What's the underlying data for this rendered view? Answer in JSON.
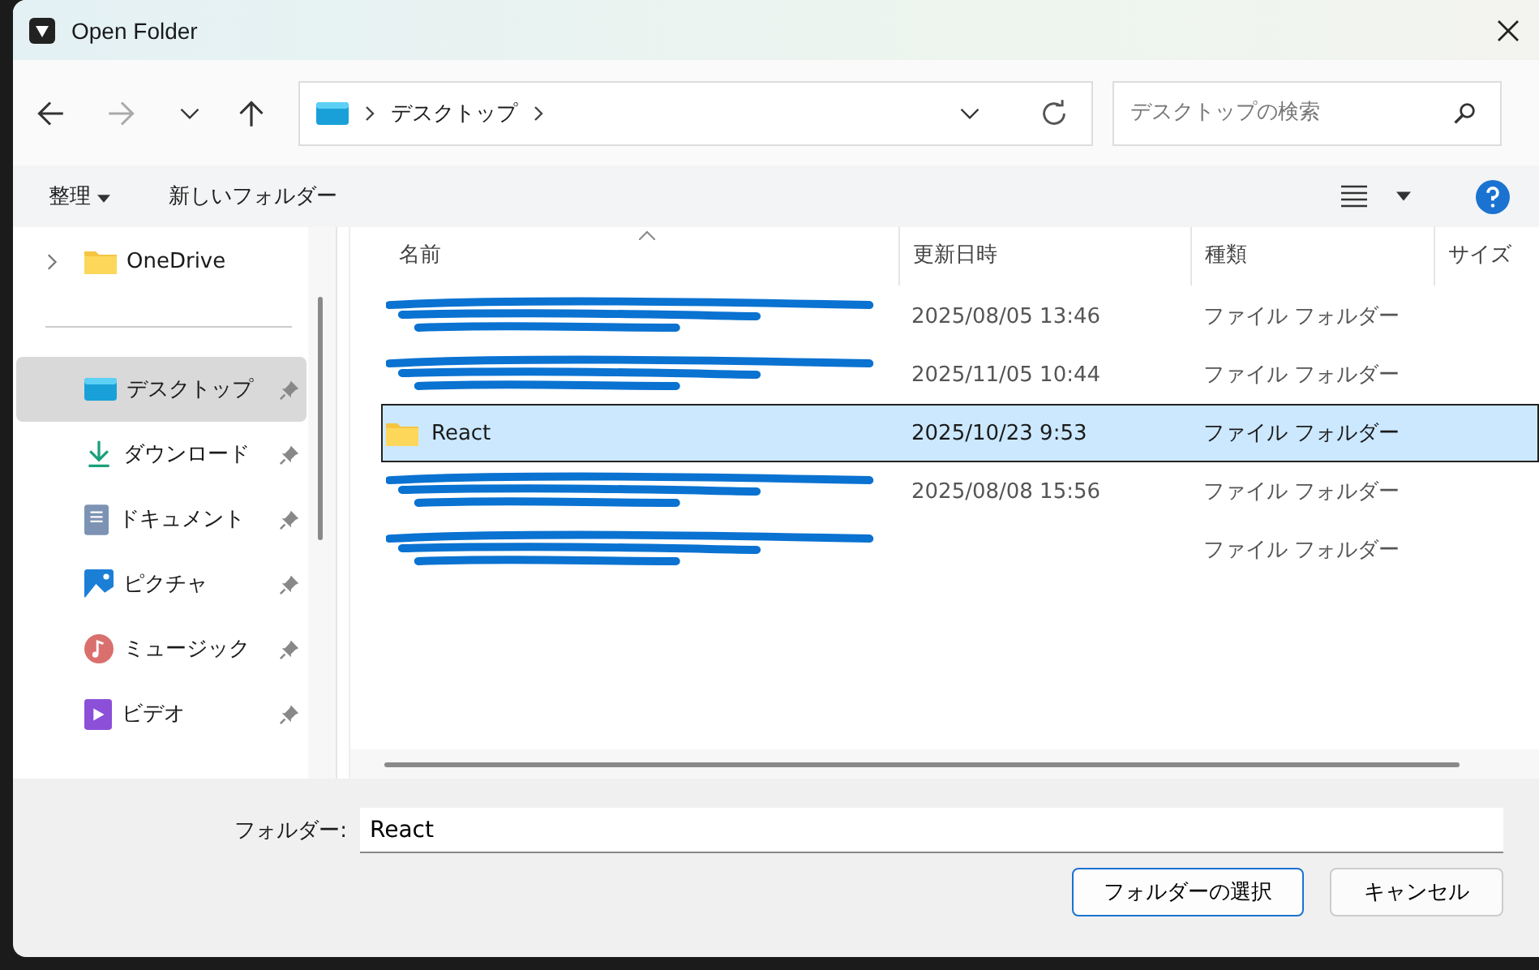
{
  "window": {
    "title": "Open Folder"
  },
  "address": {
    "crumbs": [
      "デスクトップ"
    ]
  },
  "search": {
    "placeholder": "デスクトップの検索"
  },
  "toolbar": {
    "organize": "整理",
    "new_folder": "新しいフォルダー"
  },
  "sidebar": {
    "items": [
      {
        "label": "OneDrive",
        "kind": "onedrive",
        "selected": false,
        "pinned": false
      },
      {
        "label": "デスクトップ",
        "kind": "desktop",
        "selected": true,
        "pinned": true
      },
      {
        "label": "ダウンロード",
        "kind": "download",
        "selected": false,
        "pinned": true
      },
      {
        "label": "ドキュメント",
        "kind": "document",
        "selected": false,
        "pinned": true
      },
      {
        "label": "ピクチャ",
        "kind": "picture",
        "selected": false,
        "pinned": true
      },
      {
        "label": "ミュージック",
        "kind": "music",
        "selected": false,
        "pinned": true
      },
      {
        "label": "ビデオ",
        "kind": "video",
        "selected": false,
        "pinned": true
      }
    ]
  },
  "table": {
    "columns": [
      "名前",
      "更新日時",
      "種類",
      "サイズ"
    ],
    "rows": [
      {
        "redacted": true,
        "modified": "2025/08/05 13:46",
        "type": "ファイル フォルダー",
        "selected": false
      },
      {
        "redacted": true,
        "modified": "2025/11/05 10:44",
        "type": "ファイル フォルダー",
        "selected": false
      },
      {
        "redacted": false,
        "name": "React",
        "modified": "2025/10/23 9:53",
        "type": "ファイル フォルダー",
        "selected": true
      },
      {
        "redacted": true,
        "modified": "2025/08/08 15:56",
        "type": "ファイル フォルダー",
        "selected": false
      },
      {
        "redacted": true,
        "type": "ファイル フォルダー",
        "selected": false
      }
    ]
  },
  "folder_field": {
    "label": "フォルダー:",
    "value": "React"
  },
  "buttons": [
    "フォルダーの選択",
    "キャンセル"
  ]
}
